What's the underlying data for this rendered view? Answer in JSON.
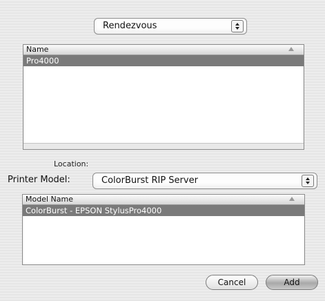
{
  "browser": {
    "selected": "Rendezvous"
  },
  "printers": {
    "column_header": "Name",
    "rows": [
      {
        "name": "Pro4000",
        "selected": true
      }
    ]
  },
  "location": {
    "label": "Location:"
  },
  "printer_model": {
    "label": "Printer Model:",
    "selected": "ColorBurst RIP Server"
  },
  "models": {
    "column_header": "Model Name",
    "rows": [
      {
        "name": "ColorBurst - EPSON StylusPro4000",
        "selected": true
      }
    ]
  },
  "buttons": {
    "cancel": "Cancel",
    "add": "Add"
  },
  "colors": {
    "selection": "#7a7a7a",
    "background": "#ececec"
  }
}
